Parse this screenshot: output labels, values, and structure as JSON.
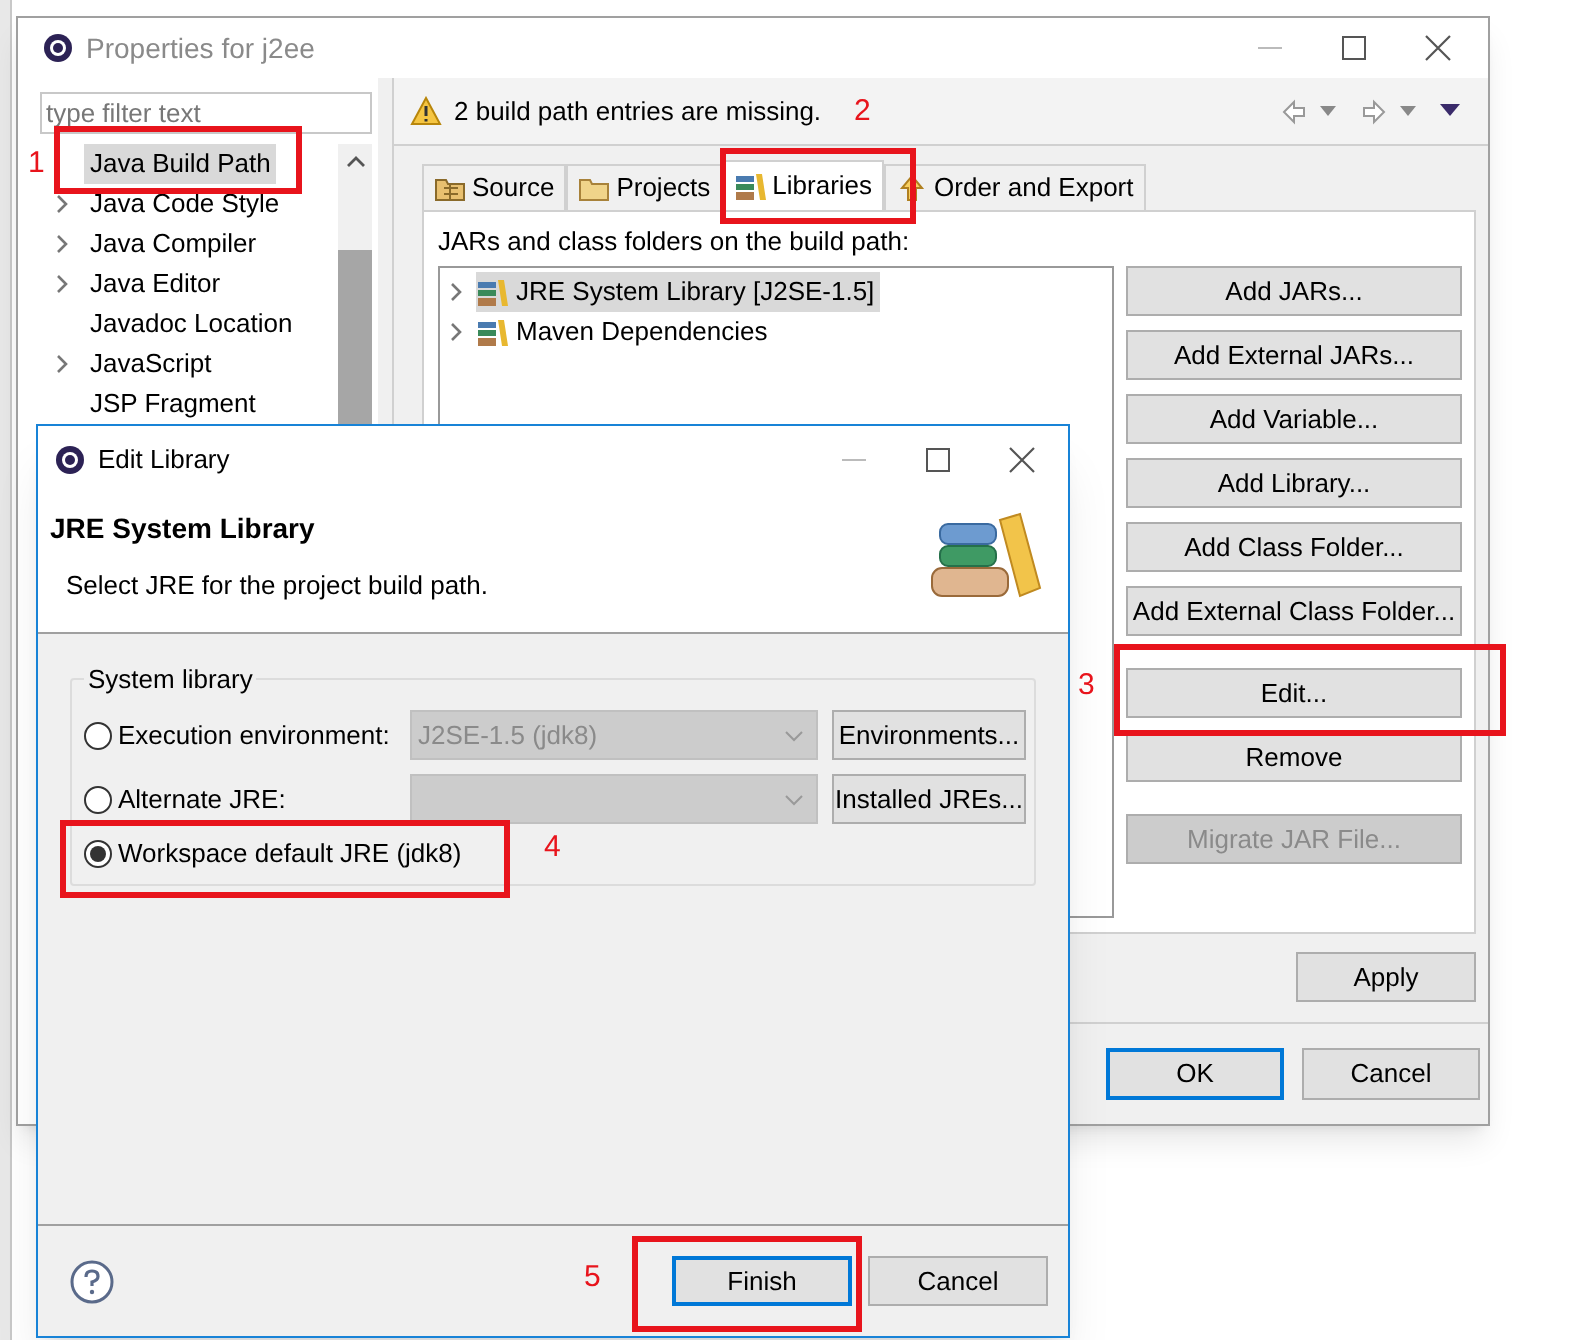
{
  "properties_window": {
    "title": "Properties for j2ee",
    "filter": {
      "placeholder": "type filter text"
    },
    "tree": [
      {
        "label": "Java Build Path",
        "selected": true,
        "expandable": false
      },
      {
        "label": "Java Code Style",
        "selected": false,
        "expandable": true
      },
      {
        "label": "Java Compiler",
        "selected": false,
        "expandable": true
      },
      {
        "label": "Java Editor",
        "selected": false,
        "expandable": true
      },
      {
        "label": "Javadoc Location",
        "selected": false,
        "expandable": false
      },
      {
        "label": "JavaScript",
        "selected": false,
        "expandable": true
      },
      {
        "label": "JSP Fragment",
        "selected": false,
        "expandable": false
      }
    ],
    "message": "2 build path entries are missing.",
    "tabs": [
      {
        "label": "Source",
        "selected": false,
        "kind": "source"
      },
      {
        "label": "Projects",
        "selected": false,
        "kind": "projects"
      },
      {
        "label": "Libraries",
        "selected": true,
        "kind": "libraries"
      },
      {
        "label": "Order and Export",
        "selected": false,
        "kind": "order"
      }
    ],
    "list_caption": "JARs and class folders on the build path:",
    "entries": [
      {
        "label": "JRE System Library [J2SE-1.5]",
        "selected": true
      },
      {
        "label": "Maven Dependencies",
        "selected": false
      }
    ],
    "buttons": [
      {
        "label": "Add JARs...",
        "disabled": false
      },
      {
        "label": "Add External JARs...",
        "disabled": false
      },
      {
        "label": "Add Variable...",
        "disabled": false
      },
      {
        "label": "Add Library...",
        "disabled": false
      },
      {
        "label": "Add Class Folder...",
        "disabled": false
      },
      {
        "label": "Add External Class Folder...",
        "disabled": false
      },
      {
        "label": "Edit...",
        "disabled": false
      },
      {
        "label": "Remove",
        "disabled": false
      },
      {
        "label": "Migrate JAR File...",
        "disabled": true
      }
    ],
    "apply": "Apply",
    "dialog_buttons": [
      {
        "label": "OK",
        "default": true
      },
      {
        "label": "Cancel",
        "default": false
      }
    ]
  },
  "edit_library_dialog": {
    "title": "Edit Library",
    "heading": "JRE System Library",
    "description": "Select JRE for the project build path.",
    "group_label": "System library",
    "options": [
      {
        "label": "Execution environment:",
        "selected": false,
        "select_value": "J2SE-1.5 (jdk8)",
        "button": "Environments..."
      },
      {
        "label": "Alternate JRE:",
        "selected": false,
        "button": "Installed JREs..."
      },
      {
        "label": "Workspace default JRE (jdk8)",
        "selected": true
      }
    ],
    "dialog_buttons": [
      {
        "label": "Finish",
        "default": true
      },
      {
        "label": "Cancel",
        "default": false
      }
    ]
  },
  "annotations": [
    {
      "number": "1"
    },
    {
      "number": "2"
    },
    {
      "number": "3"
    },
    {
      "number": "4"
    },
    {
      "number": "5"
    }
  ]
}
